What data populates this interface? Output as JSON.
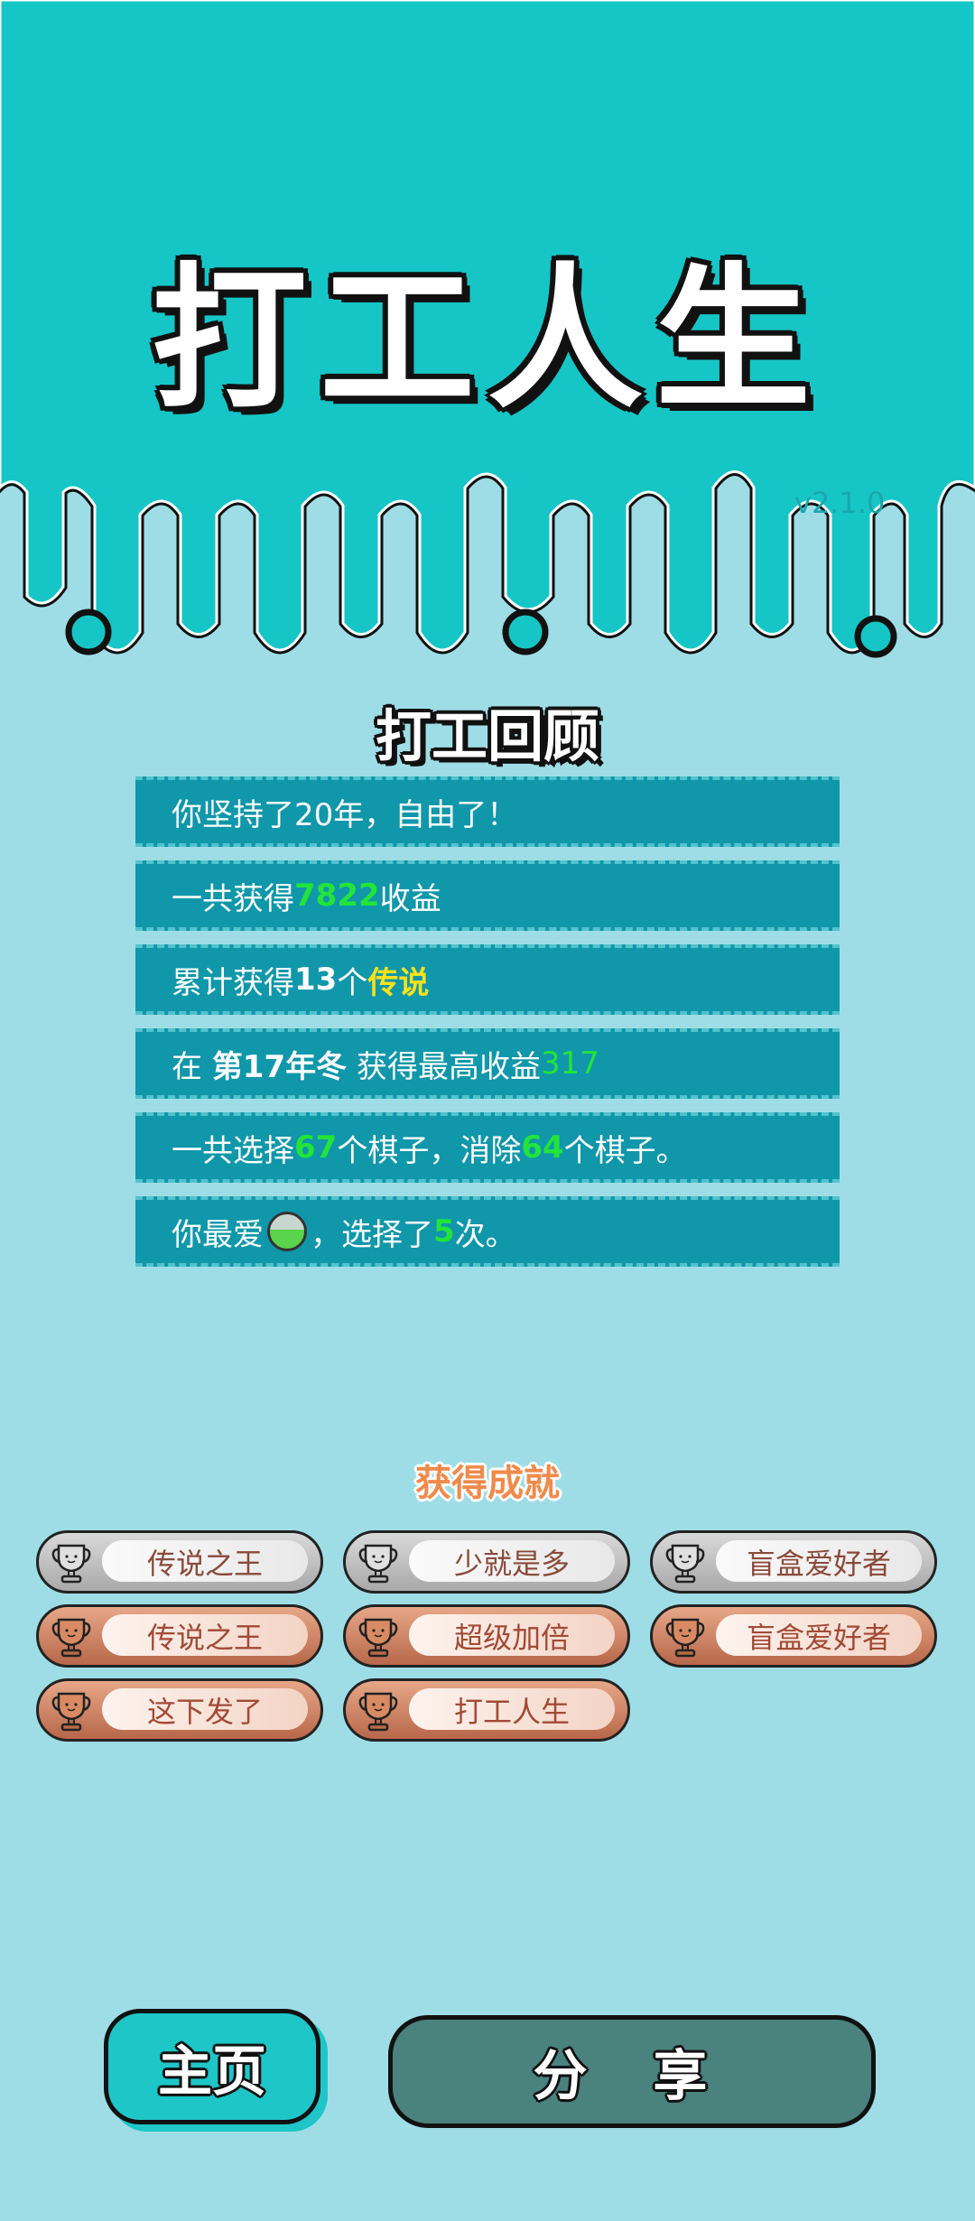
{
  "header": {
    "title": "打工人生",
    "version": "v2.1.0"
  },
  "review": {
    "title": "打工回顾",
    "rows": [
      {
        "pre": "你坚持了20年，自由了！"
      },
      {
        "pre": "一共获得",
        "hl": "7822",
        "post": "收益"
      },
      {
        "pre": "累计获得",
        "b1": "13",
        "mid": "个",
        "hl": "传说"
      },
      {
        "pre": "在 ",
        "b1": "第17年冬",
        "mid": " 获得最高收益",
        "hl": "317"
      },
      {
        "pre": "一共选择",
        "hl": "67",
        "mid": "个棋子，消除",
        "hl2": "64",
        "post": "个棋子。"
      },
      {
        "pre": "你最爱",
        "icon": "green-monster-icon",
        "mid": "，选择了",
        "hl": "5",
        "post": "次。"
      }
    ]
  },
  "achievements": {
    "title": "获得成就",
    "items": [
      {
        "label": "传说之王",
        "tier": "silver"
      },
      {
        "label": "少就是多",
        "tier": "silver"
      },
      {
        "label": "盲盒爱好者",
        "tier": "silver"
      },
      {
        "label": "传说之王",
        "tier": "bronze"
      },
      {
        "label": "超级加倍",
        "tier": "bronze"
      },
      {
        "label": "盲盒爱好者",
        "tier": "bronze"
      },
      {
        "label": "这下发了",
        "tier": "bronze"
      },
      {
        "label": "打工人生",
        "tier": "bronze"
      }
    ]
  },
  "buttons": {
    "home": "主页",
    "share": "分 享"
  },
  "colors": {
    "header": "#16c6c6",
    "background": "#9fdde6",
    "row": "#1097aa",
    "highlight_green": "#22e43a",
    "highlight_yellow": "#ffe21a"
  }
}
